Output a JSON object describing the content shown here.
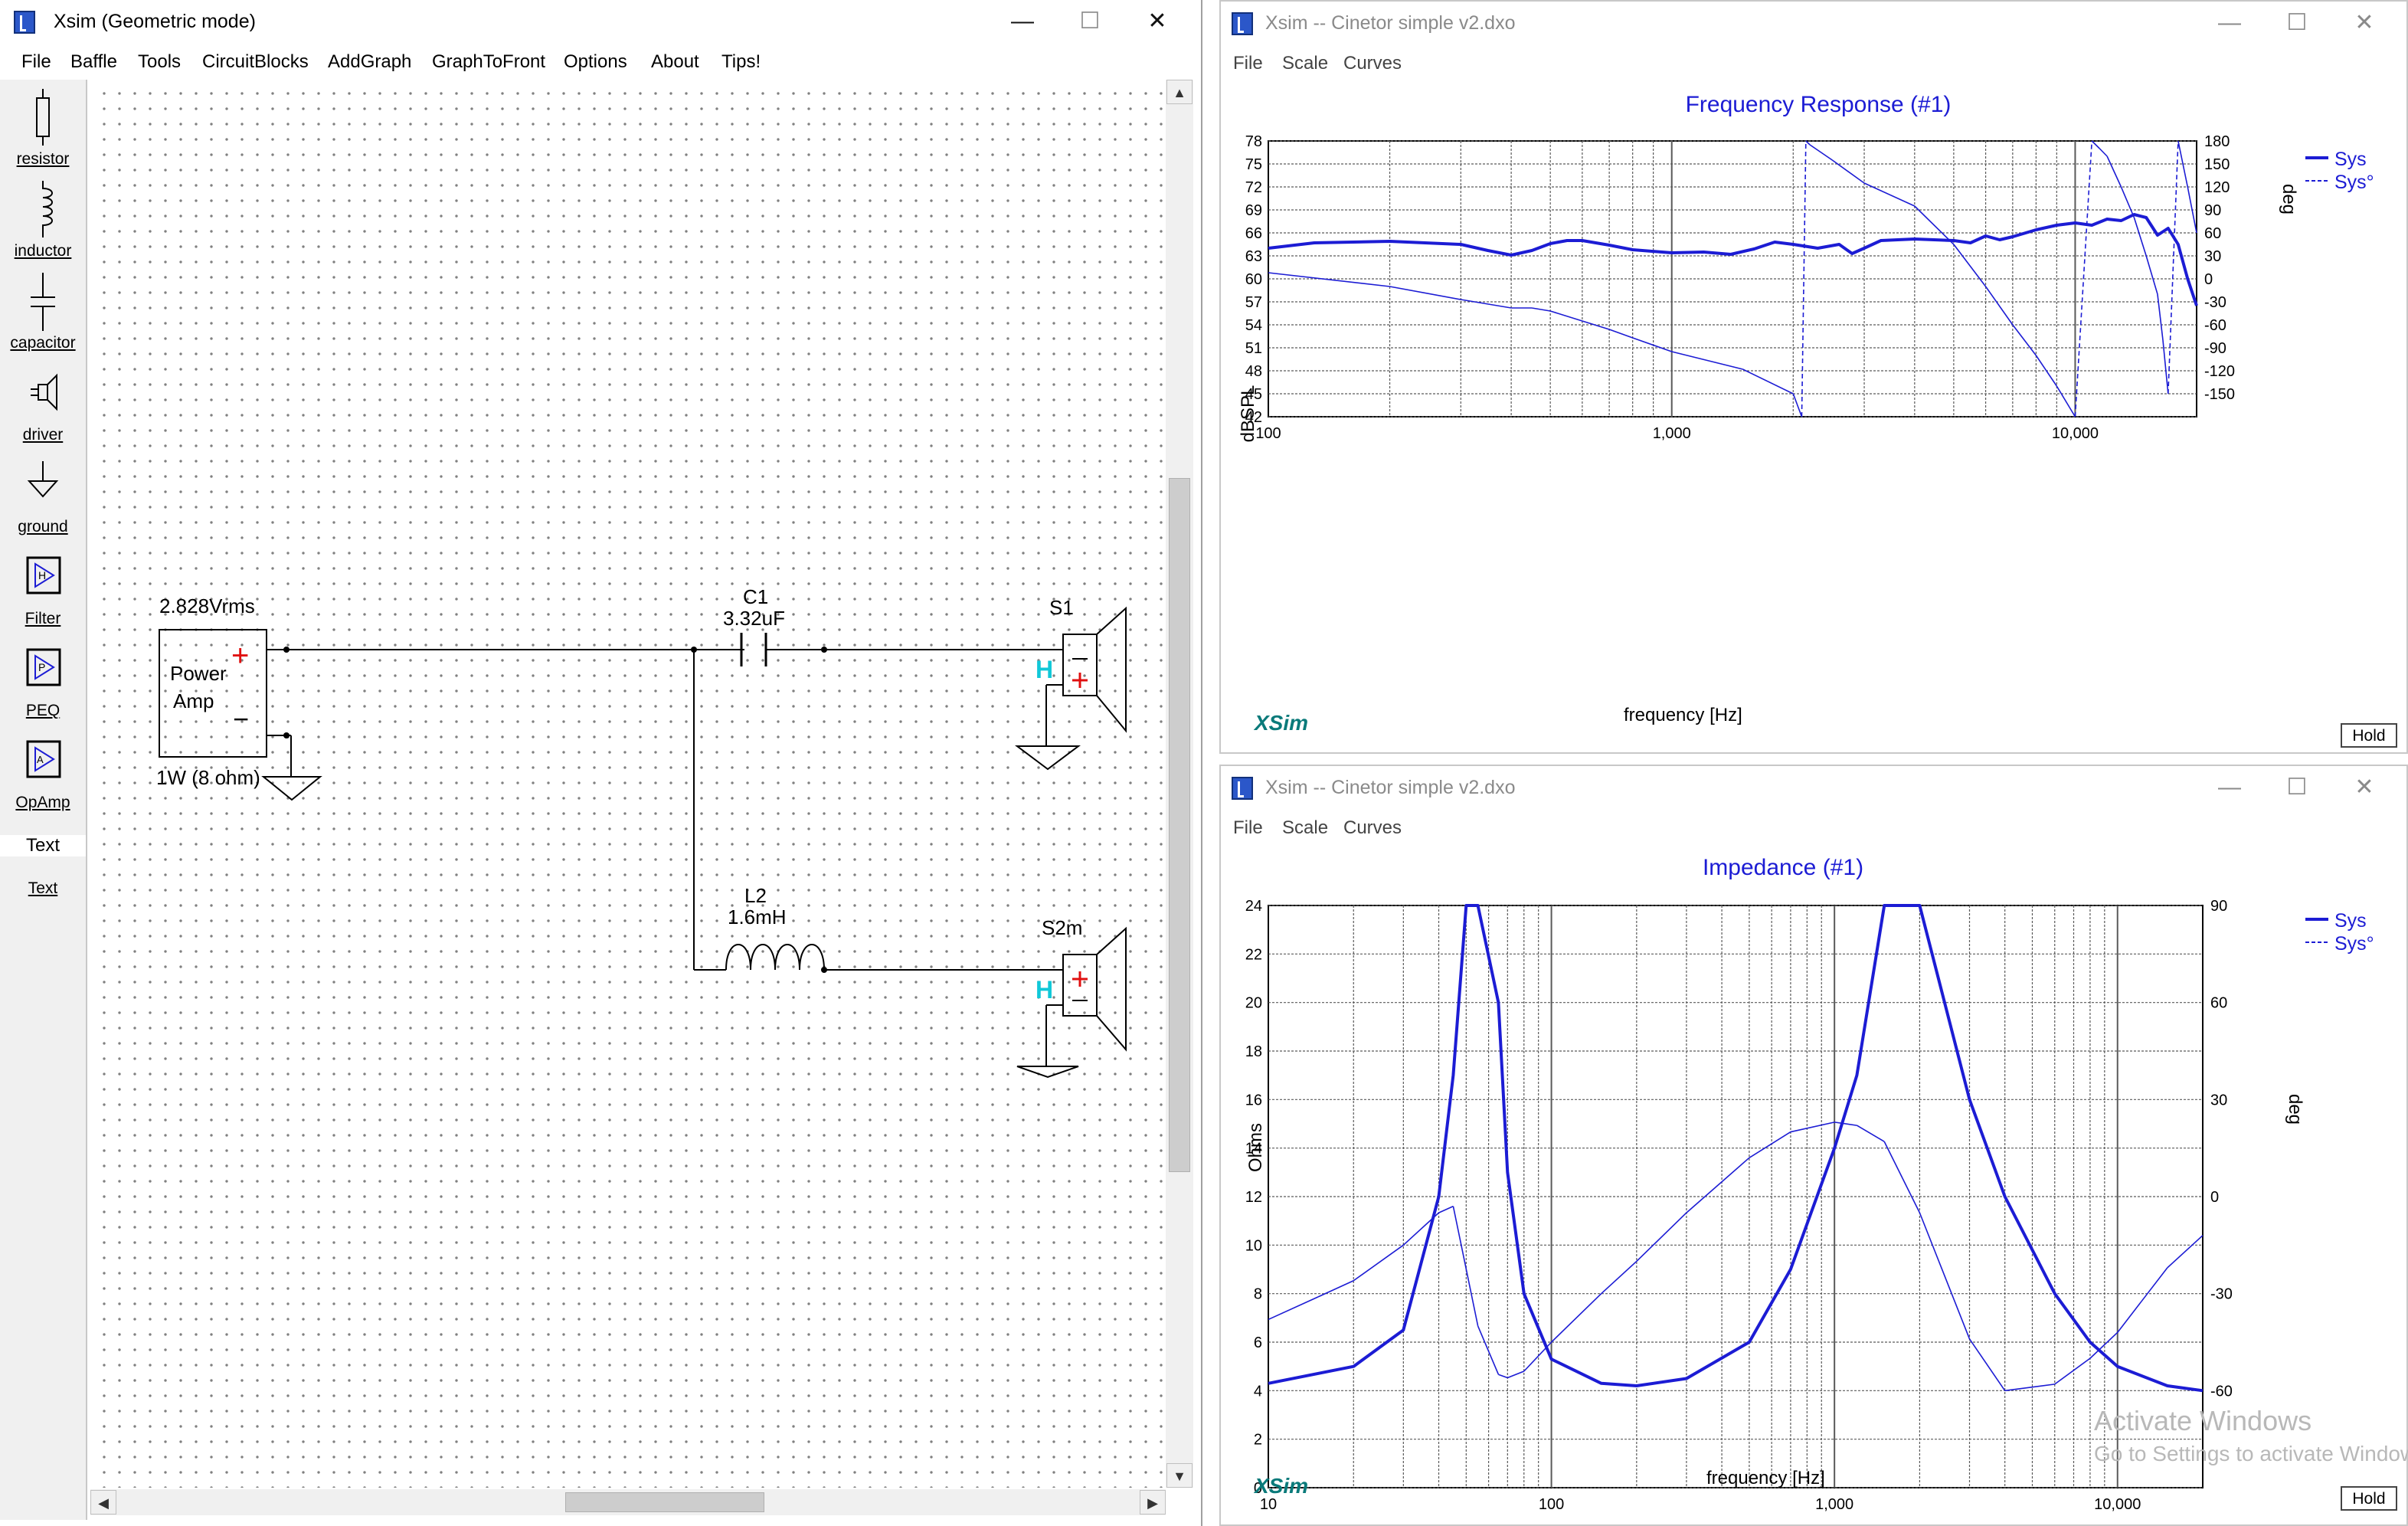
{
  "left_window": {
    "title": "Xsim (Geometric mode)",
    "menu": [
      "File",
      "Baffle",
      "Tools",
      "CircuitBlocks",
      "AddGraph",
      "GraphToFront",
      "Options",
      "About",
      "Tips!"
    ],
    "tools": [
      "resistor",
      "inductor",
      "capacitor",
      "driver",
      "ground",
      "Filter",
      "PEQ",
      "OpAmp"
    ],
    "text_tool_icon": "Text",
    "text_tool_label": "Text",
    "schematic": {
      "source_voltage": "2.828Vrms",
      "amp_line1": "Power",
      "amp_line2": "Amp",
      "amp_plus": "+",
      "amp_minus": "−",
      "power_note": "1W (8 ohm)",
      "c1_name": "C1",
      "c1_value": "3.32uF",
      "l2_name": "L2",
      "l2_value": "1.6mH",
      "s1_name": "S1",
      "s2_name": "S2m",
      "driver_h": "H"
    }
  },
  "freq_window": {
    "title": "Xsim -- Cinetor simple v2.dxo",
    "menu": [
      "File",
      "Scale",
      "Curves"
    ],
    "graph_title": "Frequency Response (#1)",
    "y_label": "dBSPL",
    "y2_label": "deg",
    "x_label": "frequency [Hz]",
    "y_ticks": [
      "78",
      "75",
      "72",
      "69",
      "66",
      "63",
      "60",
      "57",
      "54",
      "51",
      "48",
      "45",
      "42"
    ],
    "y2_ticks": [
      "180",
      "150",
      "120",
      "90",
      "60",
      "30",
      "0",
      "-30",
      "-60",
      "-90",
      "-120",
      "-150"
    ],
    "x_ticks": [
      "100",
      "1,000",
      "10,000"
    ],
    "legend": [
      "Sys",
      "Sys°"
    ],
    "brand": "XSim",
    "hold": "Hold"
  },
  "imp_window": {
    "title": "Xsim -- Cinetor simple v2.dxo",
    "menu": [
      "File",
      "Scale",
      "Curves"
    ],
    "graph_title": "Impedance (#1)",
    "y_label": "Ohms",
    "y2_label": "deg",
    "x_label": "frequency [Hz]",
    "y_ticks": [
      "24",
      "22",
      "20",
      "18",
      "16",
      "14",
      "12",
      "10",
      "8",
      "6",
      "4",
      "2",
      "0"
    ],
    "y2_ticks": [
      "90",
      "60",
      "30",
      "0",
      "-30",
      "-60"
    ],
    "x_ticks": [
      "10",
      "100",
      "1,000",
      "10,000"
    ],
    "legend": [
      "Sys",
      "Sys°"
    ],
    "brand": "XSim",
    "hold": "Hold"
  },
  "activation": {
    "line1": "Activate Windows",
    "line2": "Go to Settings to activate Windows."
  },
  "colors": {
    "curve": "#1c1cd4",
    "grid": "#5a5a5a",
    "amp_sign": "#e01010",
    "driver_h": "#10c8d8",
    "brand": "#0a7a7a"
  },
  "chart_data": [
    {
      "type": "line",
      "title": "Frequency Response (#1)",
      "xlabel": "frequency [Hz]",
      "ylabel": "dBSPL",
      "y2label": "deg",
      "x_scale": "log",
      "xlim": [
        100,
        20000
      ],
      "ylim": [
        42,
        78
      ],
      "y2lim": [
        -180,
        180
      ],
      "grid": true,
      "legend_position": "top-right",
      "series": [
        {
          "name": "Sys",
          "axis": "left",
          "style": "solid-thick",
          "x": [
            100,
            130,
            200,
            300,
            350,
            400,
            450,
            500,
            550,
            600,
            700,
            800,
            1000,
            1200,
            1400,
            1600,
            1800,
            2000,
            2300,
            2600,
            2800,
            3000,
            3300,
            4000,
            5000,
            5500,
            6000,
            6500,
            7000,
            8000,
            9000,
            10000,
            11000,
            12000,
            13000,
            14000,
            15000,
            16000,
            17000,
            18000,
            19000,
            20000
          ],
          "y": [
            64.0,
            64.7,
            64.9,
            64.5,
            63.7,
            63.1,
            63.7,
            64.6,
            65.0,
            65.0,
            64.4,
            63.8,
            63.4,
            63.5,
            63.2,
            63.9,
            64.8,
            64.5,
            64.0,
            64.5,
            63.3,
            64.0,
            65.0,
            65.2,
            65.0,
            64.7,
            65.6,
            65.1,
            65.5,
            66.4,
            67.0,
            67.3,
            67.0,
            67.8,
            67.6,
            68.4,
            68.0,
            65.7,
            66.6,
            64.5,
            60.0,
            56.5
          ]
        },
        {
          "name": "Sys°",
          "axis": "right",
          "style": "thin-with-dashed-wraps",
          "x": [
            100,
            200,
            300,
            400,
            450,
            500,
            600,
            700,
            800,
            1000,
            1500,
            2000,
            2100,
            2150,
            2200,
            2500,
            3000,
            4000,
            5000,
            6000,
            7000,
            8000,
            9000,
            10000,
            11000,
            11500,
            12000,
            13000,
            14000,
            15000,
            16000,
            16500,
            17000,
            18000,
            19000,
            20000
          ],
          "y": [
            8,
            -10,
            -27,
            -38,
            -38,
            -42,
            -55,
            -66,
            -77,
            -95,
            -118,
            -150,
            -180,
            180,
            175,
            155,
            125,
            95,
            45,
            -10,
            -60,
            -100,
            -140,
            -180,
            180,
            170,
            160,
            120,
            80,
            30,
            -20,
            -80,
            -150,
            180,
            120,
            60
          ]
        }
      ]
    },
    {
      "type": "line",
      "title": "Impedance (#1)",
      "xlabel": "frequency [Hz]",
      "ylabel": "Ohms",
      "y2label": "deg",
      "x_scale": "log",
      "xlim": [
        10,
        20000
      ],
      "ylim": [
        0,
        24
      ],
      "y2lim": [
        -90,
        90
      ],
      "grid": true,
      "legend_position": "top-right",
      "series": [
        {
          "name": "Sys",
          "axis": "left",
          "style": "solid-thick",
          "x": [
            10,
            20,
            30,
            40,
            45,
            50,
            55,
            65,
            70,
            80,
            100,
            150,
            200,
            300,
            500,
            700,
            1000,
            1200,
            1500,
            2000,
            3000,
            4000,
            6000,
            8000,
            10000,
            15000,
            20000
          ],
          "y": [
            4.3,
            5.0,
            6.5,
            12,
            17,
            28,
            28,
            20,
            13,
            8,
            5.3,
            4.3,
            4.2,
            4.5,
            6,
            9,
            14,
            17,
            30,
            30,
            16,
            12,
            8,
            6,
            5,
            4.2,
            4.0
          ]
        },
        {
          "name": "Sys°",
          "axis": "right",
          "style": "thin-with-dashed-drops",
          "x": [
            10,
            15,
            20,
            30,
            40,
            45,
            55,
            65,
            70,
            80,
            100,
            150,
            200,
            300,
            500,
            700,
            1000,
            1200,
            1500,
            2000,
            3000,
            4000,
            6000,
            8000,
            10000,
            15000,
            20000
          ],
          "y": [
            -38,
            -31,
            -26,
            -15,
            -5,
            -3,
            -40,
            -55,
            -56,
            -54,
            -45,
            -30,
            -20,
            -5,
            12,
            20,
            23,
            22,
            17,
            -5,
            -44,
            -60,
            -58,
            -50,
            -42,
            -22,
            -12
          ]
        }
      ]
    }
  ]
}
